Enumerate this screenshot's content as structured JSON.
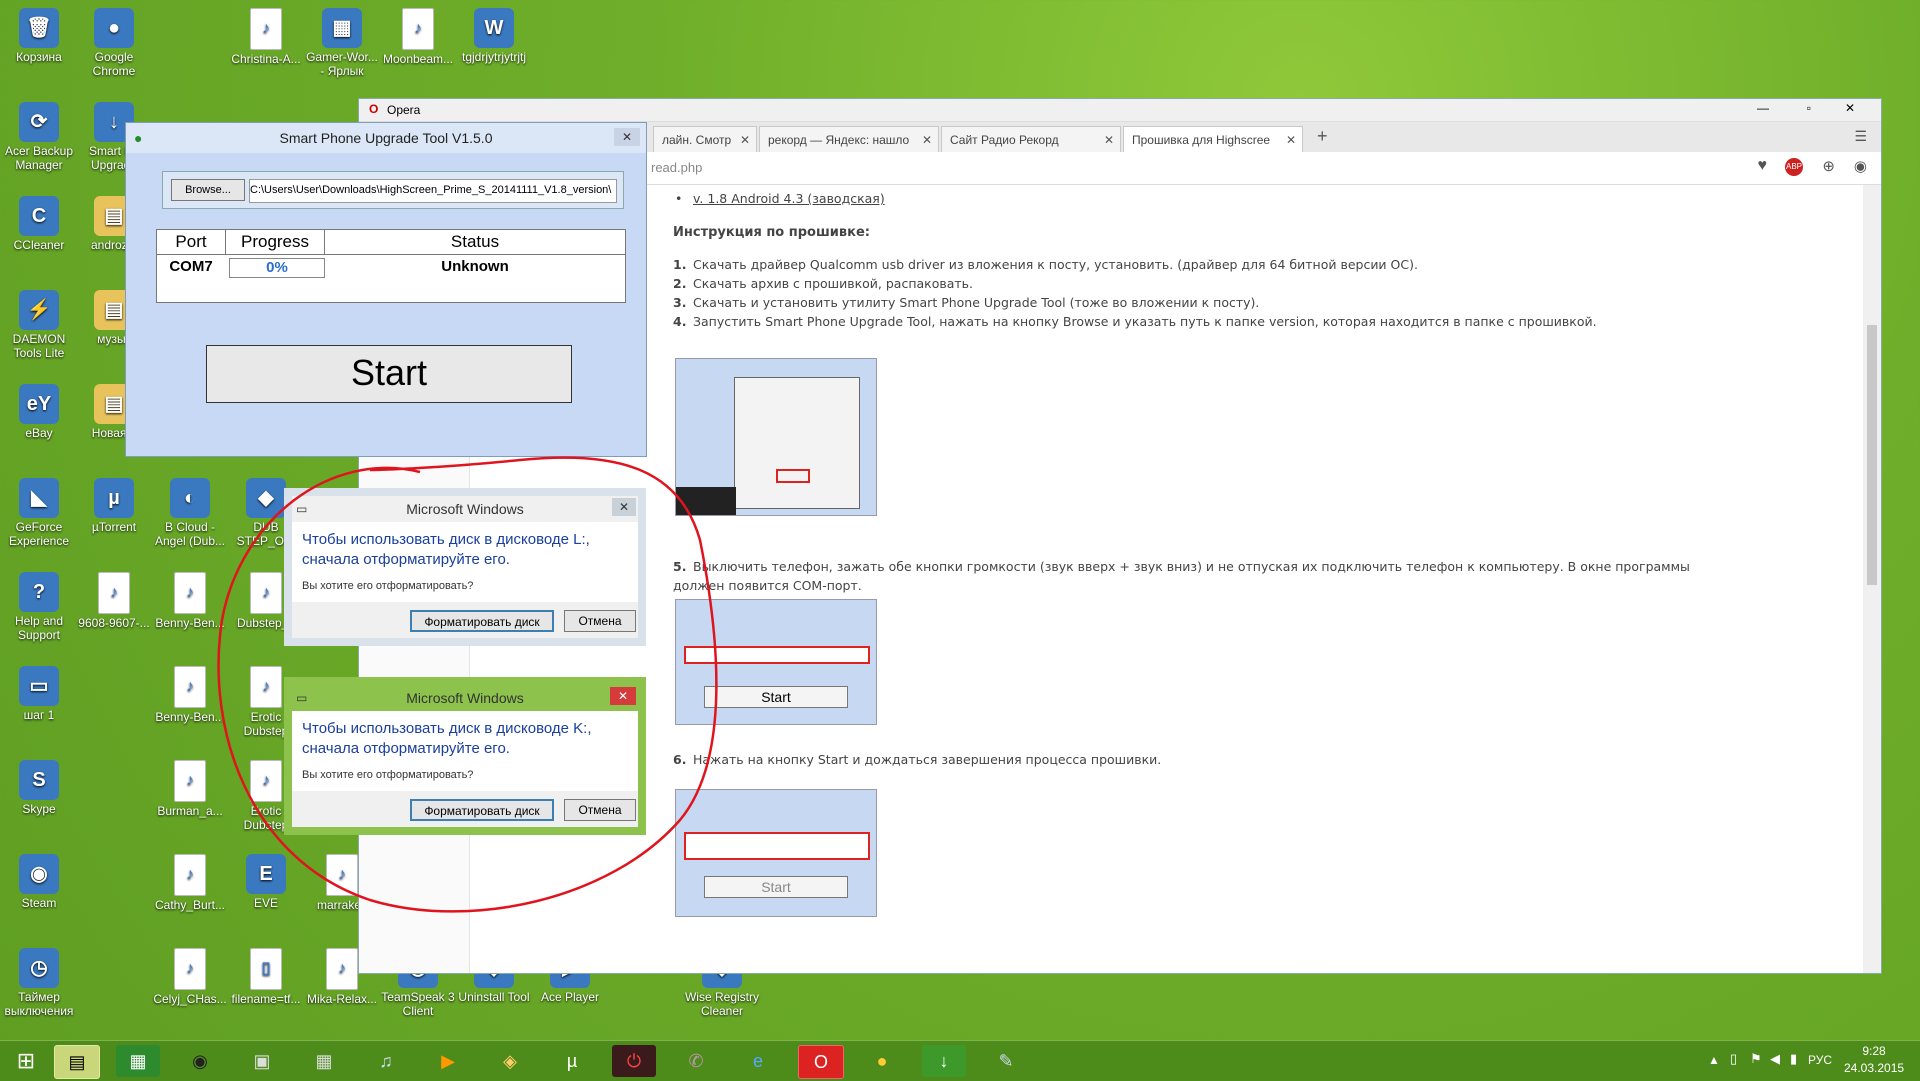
{
  "desktop": {
    "icons": [
      {
        "label": "Корзина",
        "glyph": "🗑"
      },
      {
        "label": "Google Chrome",
        "glyph": "●"
      },
      {
        "label": "Christina-A...",
        "glyph": "♪"
      },
      {
        "label": "Gamer-Wor... - Ярлык",
        "glyph": "▦"
      },
      {
        "label": "Moonbeam...",
        "glyph": "♪"
      },
      {
        "label": "tgjdrjytrjytrjtj",
        "glyph": "W"
      },
      {
        "label": "Acer Backup Manager",
        "glyph": "⟳"
      },
      {
        "label": "Smart Ph Upgrade",
        "glyph": "↓"
      },
      {
        "label": "CCleaner",
        "glyph": "C"
      },
      {
        "label": "androzip",
        "glyph": "▤"
      },
      {
        "label": "DAEMON Tools Lite",
        "glyph": "⚡"
      },
      {
        "label": "музык",
        "glyph": "▤"
      },
      {
        "label": "eBay",
        "glyph": "eY"
      },
      {
        "label": "Новая п",
        "glyph": "▤"
      },
      {
        "label": "GeForce Experience",
        "glyph": "◣"
      },
      {
        "label": "µTorrent",
        "glyph": "µ"
      },
      {
        "label": "B Cloud - Angel (Dub...",
        "glyph": "◐"
      },
      {
        "label": "DUB STEP_Owl",
        "glyph": "◆"
      },
      {
        "label": "Help and Support",
        "glyph": "?"
      },
      {
        "label": "9608-9607-...",
        "glyph": "♪"
      },
      {
        "label": "Benny-Ben...",
        "glyph": "♪"
      },
      {
        "label": "Dubstep_n",
        "glyph": "♪"
      },
      {
        "label": "шаг 1",
        "glyph": "▭"
      },
      {
        "label": "Benny-Ben...",
        "glyph": "♪"
      },
      {
        "label": "Erotic Dubstep",
        "glyph": "♪"
      },
      {
        "label": "Skype",
        "glyph": "S"
      },
      {
        "label": "Burman_a...",
        "glyph": "♪"
      },
      {
        "label": "Erotic Dubstep",
        "glyph": "♪"
      },
      {
        "label": "Steam",
        "glyph": "◉"
      },
      {
        "label": "Cathy_Burt...",
        "glyph": "♪"
      },
      {
        "label": "EVE",
        "glyph": "E"
      },
      {
        "label": "marrakes",
        "glyph": "♪"
      },
      {
        "label": "Таймер выключения",
        "glyph": "◷"
      },
      {
        "label": "Celyj_CHas...",
        "glyph": "♪"
      },
      {
        "label": "filename=tf...",
        "glyph": "▯"
      },
      {
        "label": "Mika-Relax...",
        "glyph": "♪"
      },
      {
        "label": "TeamSpeak 3 Client",
        "glyph": "◎"
      },
      {
        "label": "Uninstall Tool",
        "glyph": "◆"
      },
      {
        "label": "Ace Player",
        "glyph": "▶"
      },
      {
        "label": "Wise Registry Cleaner",
        "glyph": "◆"
      }
    ]
  },
  "browser": {
    "app_name": "Opera",
    "tabs": [
      {
        "label": "лайн. Смотр"
      },
      {
        "label": "рекорд — Яндекс: нашло"
      },
      {
        "label": "Сайт Радио Рекорд"
      },
      {
        "label": "Прошивка для Highscree"
      }
    ],
    "address": "read.php",
    "content": {
      "version_link": "v. 1.8 Android 4.3 (заводская)",
      "heading": "Инструкция по прошивке:",
      "steps": [
        {
          "n": "1.",
          "text": "Скачать драйвер Qualcomm usb driver из вложения к посту, установить. (драйвер для 64 битной версии ОС)."
        },
        {
          "n": "2.",
          "text": "Скачать архив с прошивкой, распаковать."
        },
        {
          "n": "3.",
          "text": "Скачать и установить утилиту Smart Phone Upgrade Tool (тоже во вложении к посту)."
        },
        {
          "n": "4.",
          "text": "Запустить Smart Phone Upgrade Tool, нажать на кнопку Browse и указать путь к папке version, которая находится в папке с прошивкой."
        }
      ],
      "step5_n": "5.",
      "step5_line1": "Выключить телефон, зажать обе кнопки громкости (звук вверх + звук вниз) и не отпуская их подключить телефон к компьютеру. В окне программы",
      "step5_line2": "должен появится COM-порт.",
      "step6_n": "6.",
      "step6": "Нажать на кнопку Start и дождаться завершения процесса прошивки.",
      "thumb2_start": "Start",
      "thumb3_start": "Start"
    }
  },
  "tool": {
    "title": "Smart Phone Upgrade Tool V1.5.0",
    "browse_label": "Browse...",
    "path": "C:\\Users\\User\\Downloads\\HighScreen_Prime_S_20141111_V1.8_version\\",
    "columns": [
      "Port",
      "Progress",
      "Status"
    ],
    "row": {
      "port": "COM7",
      "progress": "0%",
      "status": "Unknown"
    },
    "start_label": "Start"
  },
  "dialogs": [
    {
      "title": "Microsoft Windows",
      "message": "Чтобы использовать диск в дисководе L:, сначала отформатируйте его.",
      "question": "Вы хотите его отформатировать?",
      "format_label": "Форматировать диск",
      "cancel_label": "Отмена"
    },
    {
      "title": "Microsoft Windows",
      "message": "Чтобы использовать диск в дисководе K:, сначала отформатируйте его.",
      "question": "Вы хотите его отформатировать?",
      "format_label": "Форматировать диск",
      "cancel_label": "Отмена"
    }
  ],
  "taskbar": {
    "language": "РУС",
    "time": "9:28",
    "date": "24.03.2015"
  },
  "colors": {
    "desktop": "#6fae2a",
    "taskbar": "#4d8b1b",
    "dialog_active": "#8dc34d",
    "annotation": "#e0141e"
  }
}
